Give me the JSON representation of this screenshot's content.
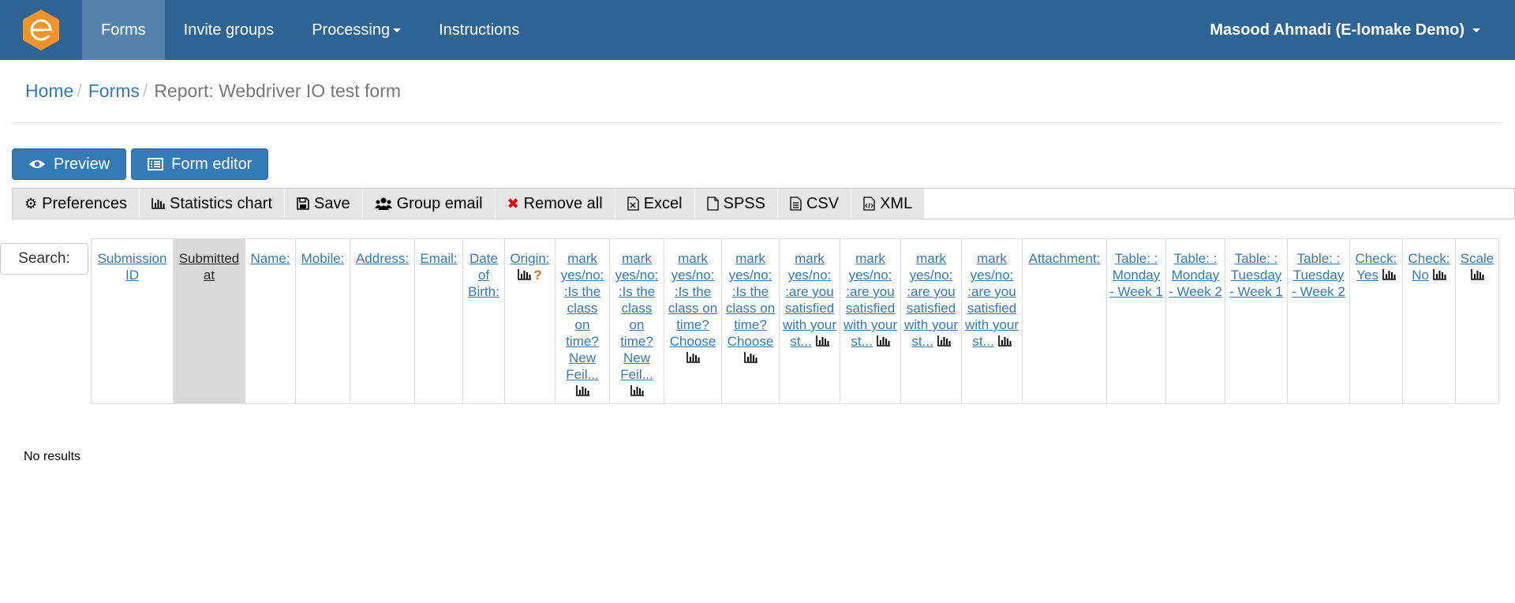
{
  "navbar": {
    "items": [
      {
        "label": "Forms",
        "active": true
      },
      {
        "label": "Invite groups",
        "active": false
      },
      {
        "label": "Processing",
        "active": false,
        "dropdown": true
      },
      {
        "label": "Instructions",
        "active": false
      }
    ],
    "user": "Masood Ahmadi (E-lomake Demo)",
    "colors": {
      "bar": "#2d6496",
      "active": "#5482ac",
      "logo": "#f0932b"
    }
  },
  "breadcrumb": {
    "home": "Home",
    "forms": "Forms",
    "current": "Report: Webdriver IO test form"
  },
  "buttons": {
    "preview": "Preview",
    "form_editor": "Form editor"
  },
  "toolbar": [
    {
      "label": "Preferences",
      "icon": "gear-icon"
    },
    {
      "label": "Statistics chart",
      "icon": "bar-chart-icon"
    },
    {
      "label": "Save",
      "icon": "floppy-icon"
    },
    {
      "label": "Group email",
      "icon": "users-icon"
    },
    {
      "label": "Remove all",
      "icon": "remove-icon"
    },
    {
      "label": "Excel",
      "icon": "excel-file-icon"
    },
    {
      "label": "SPSS",
      "icon": "file-icon"
    },
    {
      "label": "CSV",
      "icon": "text-file-icon"
    },
    {
      "label": "XML",
      "icon": "code-file-icon"
    }
  ],
  "search": {
    "label": "Search:"
  },
  "table": {
    "columns": [
      {
        "label": "Submission ID",
        "chart": false
      },
      {
        "label": "Submitted at",
        "chart": false,
        "sorted": true
      },
      {
        "label": "Name:",
        "chart": false
      },
      {
        "label": "Mobile:",
        "chart": false
      },
      {
        "label": "Address:",
        "chart": false
      },
      {
        "label": "Email:",
        "chart": false
      },
      {
        "label": "Date of Birth:",
        "chart": false
      },
      {
        "label": "Origin:",
        "chart": true,
        "help": "?"
      },
      {
        "label": "mark yes/no: :Is the class on time? New Feil...",
        "chart": true
      },
      {
        "label": "mark yes/no: :Is the class on time? New Feil...",
        "chart": true
      },
      {
        "label": "mark yes/no: :Is the class on time? Choose",
        "chart": true
      },
      {
        "label": "mark yes/no: :Is the class on time? Choose",
        "chart": true
      },
      {
        "label": "mark yes/no: :are you satisfied with your st...",
        "chart": true
      },
      {
        "label": "mark yes/no: :are you satisfied with your st...",
        "chart": true
      },
      {
        "label": "mark yes/no: :are you satisfied with your st...",
        "chart": true
      },
      {
        "label": "mark yes/no: :are you satisfied with your st...",
        "chart": true
      },
      {
        "label": "Attachment:",
        "chart": false
      },
      {
        "label": "Table: : Monday - Week 1",
        "chart": false
      },
      {
        "label": "Table: : Monday - Week 2",
        "chart": false
      },
      {
        "label": "Table: : Tuesday - Week 1",
        "chart": false
      },
      {
        "label": "Table: : Tuesday - Week 2",
        "chart": false
      },
      {
        "label": "Check: Yes",
        "chart": true
      },
      {
        "label": "Check: No",
        "chart": true
      },
      {
        "label": "Scale",
        "chart": true
      }
    ]
  },
  "no_results": "No results"
}
